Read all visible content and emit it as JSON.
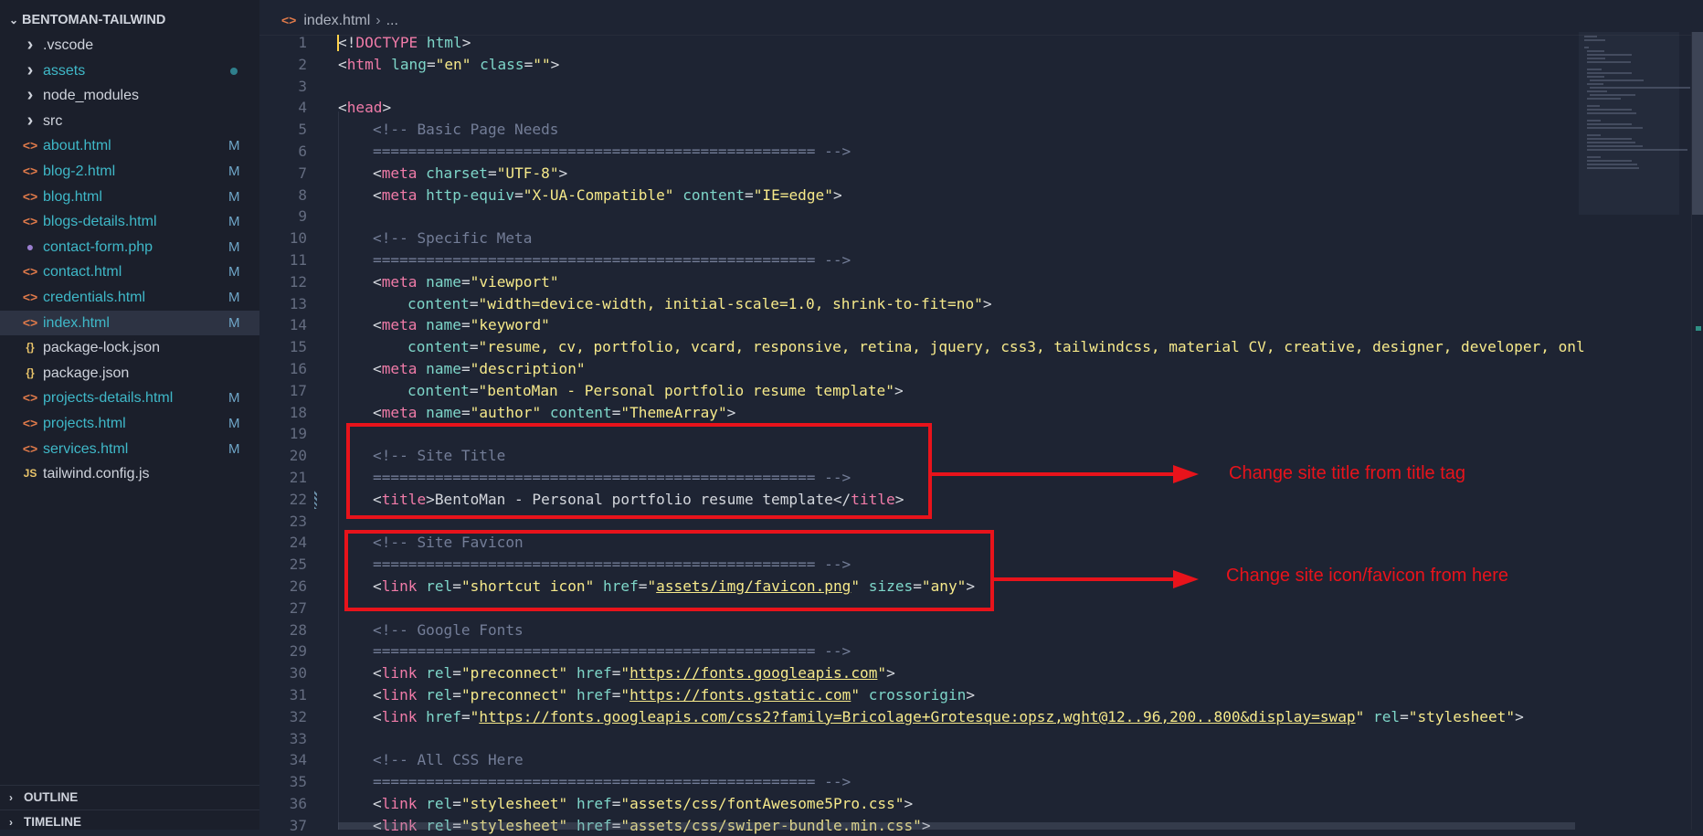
{
  "sidebar": {
    "title": "BENTOMAN-TAILWIND",
    "items": [
      {
        "name": ".vscode",
        "kind": "folder",
        "color": "#cfd3dc",
        "badge": "",
        "dot": false,
        "active": false
      },
      {
        "name": "assets",
        "kind": "folder",
        "color": "#3fb8c8",
        "badge": "",
        "dot": true,
        "active": false
      },
      {
        "name": "node_modules",
        "kind": "folder",
        "color": "#cfd3dc",
        "badge": "",
        "dot": false,
        "active": false
      },
      {
        "name": "src",
        "kind": "folder",
        "color": "#cfd3dc",
        "badge": "",
        "dot": false,
        "active": false
      },
      {
        "name": "about.html",
        "kind": "html",
        "color": "#3fb8c8",
        "badge": "M",
        "dot": false,
        "active": false
      },
      {
        "name": "blog-2.html",
        "kind": "html",
        "color": "#3fb8c8",
        "badge": "M",
        "dot": false,
        "active": false
      },
      {
        "name": "blog.html",
        "kind": "html",
        "color": "#3fb8c8",
        "badge": "M",
        "dot": false,
        "active": false
      },
      {
        "name": "blogs-details.html",
        "kind": "html",
        "color": "#3fb8c8",
        "badge": "M",
        "dot": false,
        "active": false
      },
      {
        "name": "contact-form.php",
        "kind": "php",
        "color": "#3fb8c8",
        "badge": "M",
        "dot": false,
        "active": false
      },
      {
        "name": "contact.html",
        "kind": "html",
        "color": "#3fb8c8",
        "badge": "M",
        "dot": false,
        "active": false
      },
      {
        "name": "credentials.html",
        "kind": "html",
        "color": "#3fb8c8",
        "badge": "M",
        "dot": false,
        "active": false
      },
      {
        "name": "index.html",
        "kind": "html",
        "color": "#3fb8c8",
        "badge": "M",
        "dot": false,
        "active": true
      },
      {
        "name": "package-lock.json",
        "kind": "json",
        "color": "#cfd3dc",
        "badge": "",
        "dot": false,
        "active": false
      },
      {
        "name": "package.json",
        "kind": "json",
        "color": "#cfd3dc",
        "badge": "",
        "dot": false,
        "active": false
      },
      {
        "name": "projects-details.html",
        "kind": "html",
        "color": "#3fb8c8",
        "badge": "M",
        "dot": false,
        "active": false
      },
      {
        "name": "projects.html",
        "kind": "html",
        "color": "#3fb8c8",
        "badge": "M",
        "dot": false,
        "active": false
      },
      {
        "name": "services.html",
        "kind": "html",
        "color": "#3fb8c8",
        "badge": "M",
        "dot": false,
        "active": false
      },
      {
        "name": "tailwind.config.js",
        "kind": "js",
        "color": "#cfd3dc",
        "badge": "",
        "dot": false,
        "active": false
      }
    ],
    "outline_label": "OUTLINE",
    "timeline_label": "TIMELINE"
  },
  "icons": {
    "folder": "chevron-right-icon",
    "html": "html-file-icon",
    "php": "php-file-icon",
    "json": "json-file-icon",
    "js": "js-file-icon"
  },
  "editor": {
    "breadcrumb": {
      "file": "index.html",
      "rest": "..."
    },
    "lines": [
      {
        "n": "1",
        "indent": 0,
        "tokens": [
          [
            "p",
            "<!"
          ],
          [
            "t",
            "DOCTYPE"
          ],
          [
            "p",
            " "
          ],
          [
            "a",
            "html"
          ],
          [
            "p",
            ">"
          ]
        ]
      },
      {
        "n": "2",
        "indent": 0,
        "tokens": [
          [
            "p",
            "<"
          ],
          [
            "t",
            "html"
          ],
          [
            "p",
            " "
          ],
          [
            "a",
            "lang"
          ],
          [
            "p",
            "="
          ],
          [
            "s",
            "\"en\""
          ],
          [
            "p",
            " "
          ],
          [
            "a",
            "class"
          ],
          [
            "p",
            "="
          ],
          [
            "s",
            "\"\""
          ],
          [
            "p",
            ">"
          ]
        ]
      },
      {
        "n": "3",
        "indent": 0,
        "tokens": []
      },
      {
        "n": "4",
        "indent": 0,
        "tokens": [
          [
            "p",
            "<"
          ],
          [
            "t",
            "head"
          ],
          [
            "p",
            ">"
          ]
        ]
      },
      {
        "n": "5",
        "indent": 1,
        "tokens": [
          [
            "c",
            "<!-- Basic Page Needs"
          ]
        ]
      },
      {
        "n": "6",
        "indent": 1,
        "tokens": [
          [
            "c",
            "================================================== -->"
          ]
        ]
      },
      {
        "n": "7",
        "indent": 1,
        "tokens": [
          [
            "p",
            "<"
          ],
          [
            "t",
            "meta"
          ],
          [
            "p",
            " "
          ],
          [
            "a",
            "charset"
          ],
          [
            "p",
            "="
          ],
          [
            "s",
            "\"UTF-8\""
          ],
          [
            "p",
            ">"
          ]
        ]
      },
      {
        "n": "8",
        "indent": 1,
        "tokens": [
          [
            "p",
            "<"
          ],
          [
            "t",
            "meta"
          ],
          [
            "p",
            " "
          ],
          [
            "a",
            "http-equiv"
          ],
          [
            "p",
            "="
          ],
          [
            "s",
            "\"X-UA-Compatible\""
          ],
          [
            "p",
            " "
          ],
          [
            "a",
            "content"
          ],
          [
            "p",
            "="
          ],
          [
            "s",
            "\"IE=edge\""
          ],
          [
            "p",
            ">"
          ]
        ]
      },
      {
        "n": "9",
        "indent": 0,
        "tokens": []
      },
      {
        "n": "10",
        "indent": 1,
        "tokens": [
          [
            "c",
            "<!-- Specific Meta"
          ]
        ]
      },
      {
        "n": "11",
        "indent": 1,
        "tokens": [
          [
            "c",
            "================================================== -->"
          ]
        ]
      },
      {
        "n": "12",
        "indent": 1,
        "tokens": [
          [
            "p",
            "<"
          ],
          [
            "t",
            "meta"
          ],
          [
            "p",
            " "
          ],
          [
            "a",
            "name"
          ],
          [
            "p",
            "="
          ],
          [
            "s",
            "\"viewport\""
          ]
        ]
      },
      {
        "n": "13",
        "indent": 2,
        "tokens": [
          [
            "a",
            "content"
          ],
          [
            "p",
            "="
          ],
          [
            "s",
            "\"width=device-width, initial-scale=1.0, shrink-to-fit=no\""
          ],
          [
            "p",
            ">"
          ]
        ]
      },
      {
        "n": "14",
        "indent": 1,
        "tokens": [
          [
            "p",
            "<"
          ],
          [
            "t",
            "meta"
          ],
          [
            "p",
            " "
          ],
          [
            "a",
            "name"
          ],
          [
            "p",
            "="
          ],
          [
            "s",
            "\"keyword\""
          ]
        ]
      },
      {
        "n": "15",
        "indent": 2,
        "tokens": [
          [
            "a",
            "content"
          ],
          [
            "p",
            "="
          ],
          [
            "s",
            "\"resume, cv, portfolio, vcard, responsive, retina, jquery, css3, tailwindcss, material CV, creative, designer, developer, onl"
          ]
        ]
      },
      {
        "n": "16",
        "indent": 1,
        "tokens": [
          [
            "p",
            "<"
          ],
          [
            "t",
            "meta"
          ],
          [
            "p",
            " "
          ],
          [
            "a",
            "name"
          ],
          [
            "p",
            "="
          ],
          [
            "s",
            "\"description\""
          ]
        ]
      },
      {
        "n": "17",
        "indent": 2,
        "tokens": [
          [
            "a",
            "content"
          ],
          [
            "p",
            "="
          ],
          [
            "s",
            "\"bentoMan - Personal portfolio resume template\""
          ],
          [
            "p",
            ">"
          ]
        ]
      },
      {
        "n": "18",
        "indent": 1,
        "tokens": [
          [
            "p",
            "<"
          ],
          [
            "t",
            "meta"
          ],
          [
            "p",
            " "
          ],
          [
            "a",
            "name"
          ],
          [
            "p",
            "="
          ],
          [
            "s",
            "\"author\""
          ],
          [
            "p",
            " "
          ],
          [
            "a",
            "content"
          ],
          [
            "p",
            "="
          ],
          [
            "s",
            "\"ThemeArray\""
          ],
          [
            "p",
            ">"
          ]
        ]
      },
      {
        "n": "19",
        "indent": 0,
        "tokens": []
      },
      {
        "n": "20",
        "indent": 1,
        "tokens": [
          [
            "c",
            "<!-- Site Title"
          ]
        ]
      },
      {
        "n": "21",
        "indent": 1,
        "tokens": [
          [
            "c",
            "================================================== -->"
          ]
        ]
      },
      {
        "n": "22",
        "indent": 1,
        "tokens": [
          [
            "p",
            "<"
          ],
          [
            "t",
            "title"
          ],
          [
            "p",
            ">BentoMan - Personal portfolio resume template</"
          ],
          [
            "t",
            "title"
          ],
          [
            "p",
            ">"
          ]
        ]
      },
      {
        "n": "23",
        "indent": 0,
        "tokens": []
      },
      {
        "n": "24",
        "indent": 1,
        "tokens": [
          [
            "c",
            "<!-- Site Favicon"
          ]
        ]
      },
      {
        "n": "25",
        "indent": 1,
        "tokens": [
          [
            "c",
            "================================================== -->"
          ]
        ]
      },
      {
        "n": "26",
        "indent": 1,
        "tokens": [
          [
            "p",
            "<"
          ],
          [
            "t",
            "link"
          ],
          [
            "p",
            " "
          ],
          [
            "a",
            "rel"
          ],
          [
            "p",
            "="
          ],
          [
            "s",
            "\"shortcut icon\""
          ],
          [
            "p",
            " "
          ],
          [
            "a",
            "href"
          ],
          [
            "p",
            "="
          ],
          [
            "s",
            "\""
          ],
          [
            "u",
            "assets/img/favicon.png"
          ],
          [
            "s",
            "\""
          ],
          [
            "p",
            " "
          ],
          [
            "a",
            "sizes"
          ],
          [
            "p",
            "="
          ],
          [
            "s",
            "\"any\""
          ],
          [
            "p",
            ">"
          ]
        ]
      },
      {
        "n": "27",
        "indent": 0,
        "tokens": []
      },
      {
        "n": "28",
        "indent": 1,
        "tokens": [
          [
            "c",
            "<!-- Google Fonts"
          ]
        ]
      },
      {
        "n": "29",
        "indent": 1,
        "tokens": [
          [
            "c",
            "================================================== -->"
          ]
        ]
      },
      {
        "n": "30",
        "indent": 1,
        "tokens": [
          [
            "p",
            "<"
          ],
          [
            "t",
            "link"
          ],
          [
            "p",
            " "
          ],
          [
            "a",
            "rel"
          ],
          [
            "p",
            "="
          ],
          [
            "s",
            "\"preconnect\""
          ],
          [
            "p",
            " "
          ],
          [
            "a",
            "href"
          ],
          [
            "p",
            "="
          ],
          [
            "s",
            "\""
          ],
          [
            "u",
            "https://fonts.googleapis.com"
          ],
          [
            "s",
            "\""
          ],
          [
            "p",
            ">"
          ]
        ]
      },
      {
        "n": "31",
        "indent": 1,
        "tokens": [
          [
            "p",
            "<"
          ],
          [
            "t",
            "link"
          ],
          [
            "p",
            " "
          ],
          [
            "a",
            "rel"
          ],
          [
            "p",
            "="
          ],
          [
            "s",
            "\"preconnect\""
          ],
          [
            "p",
            " "
          ],
          [
            "a",
            "href"
          ],
          [
            "p",
            "="
          ],
          [
            "s",
            "\""
          ],
          [
            "u",
            "https://fonts.gstatic.com"
          ],
          [
            "s",
            "\""
          ],
          [
            "p",
            " "
          ],
          [
            "a",
            "crossorigin"
          ],
          [
            "p",
            ">"
          ]
        ]
      },
      {
        "n": "32",
        "indent": 1,
        "tokens": [
          [
            "p",
            "<"
          ],
          [
            "t",
            "link"
          ],
          [
            "p",
            " "
          ],
          [
            "a",
            "href"
          ],
          [
            "p",
            "="
          ],
          [
            "s",
            "\""
          ],
          [
            "u",
            "https://fonts.googleapis.com/css2?family=Bricolage+Grotesque:opsz,wght@12..96,200..800&display=swap"
          ],
          [
            "s",
            "\""
          ],
          [
            "p",
            " "
          ],
          [
            "a",
            "rel"
          ],
          [
            "p",
            "="
          ],
          [
            "s",
            "\"stylesheet\""
          ],
          [
            "p",
            ">"
          ]
        ]
      },
      {
        "n": "33",
        "indent": 0,
        "tokens": []
      },
      {
        "n": "34",
        "indent": 1,
        "tokens": [
          [
            "c",
            "<!-- All CSS Here"
          ]
        ]
      },
      {
        "n": "35",
        "indent": 1,
        "tokens": [
          [
            "c",
            "================================================== -->"
          ]
        ]
      },
      {
        "n": "36",
        "indent": 1,
        "tokens": [
          [
            "p",
            "<"
          ],
          [
            "t",
            "link"
          ],
          [
            "p",
            " "
          ],
          [
            "a",
            "rel"
          ],
          [
            "p",
            "="
          ],
          [
            "s",
            "\"stylesheet\""
          ],
          [
            "p",
            " "
          ],
          [
            "a",
            "href"
          ],
          [
            "p",
            "="
          ],
          [
            "s",
            "\"assets/css/fontAwesome5Pro.css\""
          ],
          [
            "p",
            ">"
          ]
        ]
      },
      {
        "n": "37",
        "indent": 1,
        "tokens": [
          [
            "p",
            "<"
          ],
          [
            "t",
            "link"
          ],
          [
            "p",
            " "
          ],
          [
            "a",
            "rel"
          ],
          [
            "p",
            "="
          ],
          [
            "s",
            "\"stylesheet\""
          ],
          [
            "p",
            " "
          ],
          [
            "a",
            "href"
          ],
          [
            "p",
            "="
          ],
          [
            "s",
            "\"assets/css/swiper-bundle.min.css\""
          ],
          [
            "p",
            ">"
          ]
        ]
      }
    ]
  },
  "annotations": {
    "title_note": "Change site title from title tag",
    "favicon_note": "Change site icon/favicon from here",
    "color": "#e8131b"
  },
  "colors": {
    "background": "#1e2433",
    "sidebar": "#1b1f2b",
    "tag": "#f07ba8",
    "attribute": "#7ed6c9",
    "string": "#f6e98a",
    "comment": "#737d97",
    "modified_badge": "#6fa6c8"
  }
}
